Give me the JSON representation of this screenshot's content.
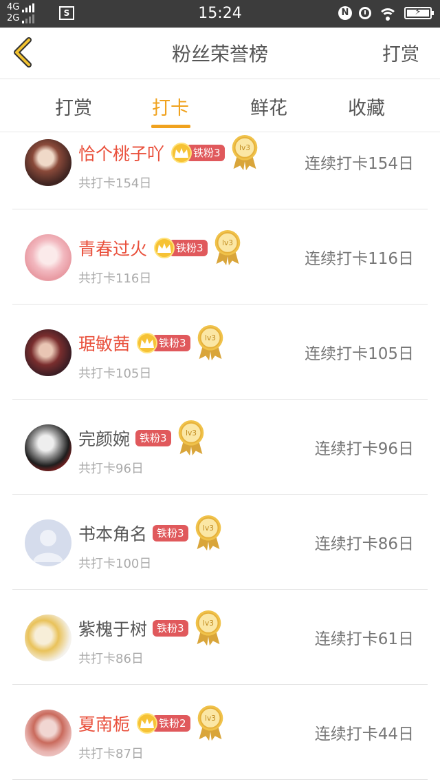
{
  "status_bar": {
    "network_top": "4G",
    "network_bottom": "2G",
    "screenshot_glyph": "S",
    "time": "15:24",
    "nfc": "N",
    "battery_icon": "battery-charging-icon"
  },
  "header": {
    "title": "粉丝荣誉榜",
    "right_action": "打赏"
  },
  "tabs": [
    {
      "label": "打赏",
      "active": false
    },
    {
      "label": "打卡",
      "active": true
    },
    {
      "label": "鲜花",
      "active": false
    },
    {
      "label": "收藏",
      "active": false
    }
  ],
  "items": [
    {
      "name": "恰个桃子吖",
      "vip": true,
      "fan_badge": "铁粉3",
      "medal": "lv3",
      "total": "共打卡154日",
      "streak": "连续打卡154日"
    },
    {
      "name": "青春过火",
      "vip": true,
      "fan_badge": "铁粉3",
      "medal": "lv3",
      "total": "共打卡116日",
      "streak": "连续打卡116日"
    },
    {
      "name": "琚敏茜",
      "vip": true,
      "fan_badge": "铁粉3",
      "medal": "lv3",
      "total": "共打卡105日",
      "streak": "连续打卡105日"
    },
    {
      "name": "完颜婉",
      "vip": false,
      "fan_badge": "铁粉3",
      "medal": "lv3",
      "total": "共打卡96日",
      "streak": "连续打卡96日"
    },
    {
      "name": "书本角名",
      "vip": false,
      "fan_badge": "铁粉3",
      "medal": "lv3",
      "total": "共打卡100日",
      "streak": "连续打卡86日"
    },
    {
      "name": "紫槐于树",
      "vip": false,
      "fan_badge": "铁粉3",
      "medal": "lv3",
      "total": "共打卡86日",
      "streak": "连续打卡61日"
    },
    {
      "name": "夏南栀",
      "vip": true,
      "fan_badge": "铁粉2",
      "medal": "lv3",
      "total": "共打卡87日",
      "streak": "连续打卡44日"
    }
  ],
  "colors": {
    "accent": "#f0a21e",
    "vip_name": "#e9503c",
    "badge": "#e0595c",
    "status_bar": "#3c3c3c"
  }
}
